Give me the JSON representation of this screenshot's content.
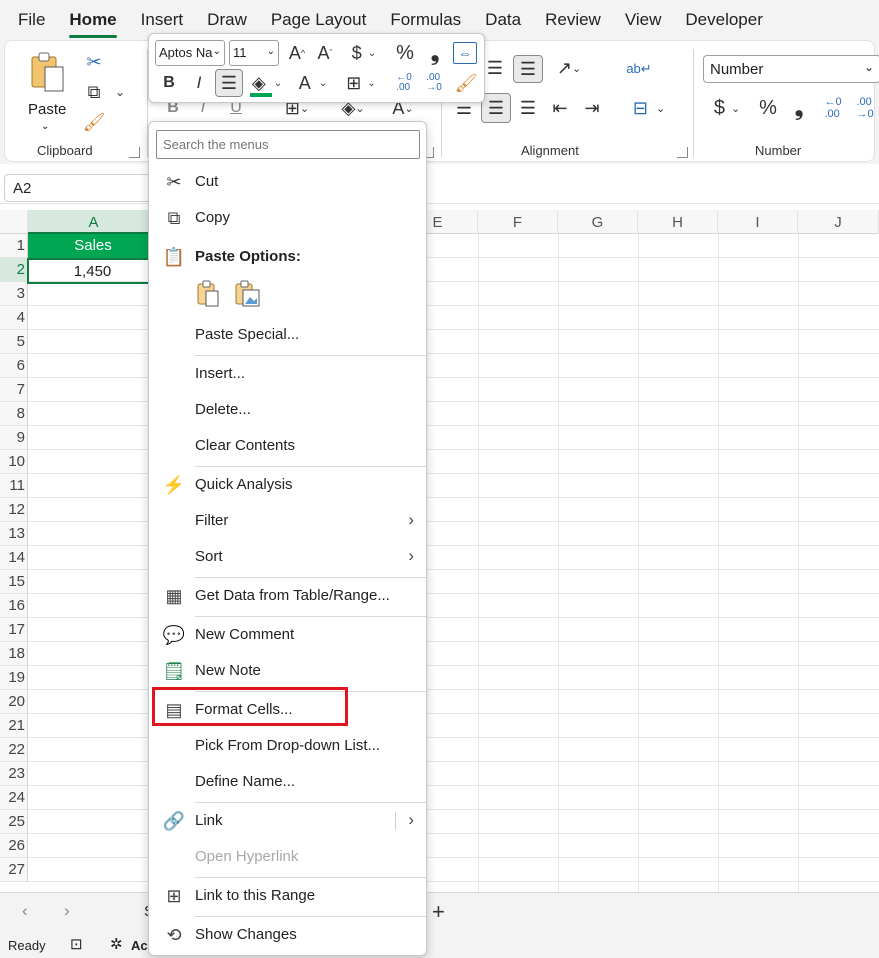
{
  "menubar": {
    "tabs": [
      "File",
      "Home",
      "Insert",
      "Draw",
      "Page Layout",
      "Formulas",
      "Data",
      "Review",
      "View",
      "Developer"
    ],
    "active": "Home"
  },
  "ribbon": {
    "clipboard": {
      "paste_label": "Paste",
      "group_label": "Clipboard"
    },
    "alignment": {
      "group_label": "Alignment"
    },
    "number": {
      "group_label": "Number",
      "format_value": "Number"
    }
  },
  "mini_toolbar": {
    "font_name": "Aptos Na",
    "font_size": "11"
  },
  "namebox": {
    "value": "A2"
  },
  "grid": {
    "columns": [
      "A",
      "E",
      "F",
      "G",
      "H",
      "I",
      "J"
    ],
    "rows": [
      "1",
      "2",
      "3",
      "4",
      "5",
      "6",
      "7",
      "8",
      "9",
      "10",
      "11",
      "12",
      "13",
      "14",
      "15",
      "16",
      "17",
      "18",
      "19",
      "20",
      "21",
      "22",
      "23",
      "24",
      "25",
      "26",
      "27"
    ],
    "a1": "Sales",
    "a2": "1,450"
  },
  "context_menu": {
    "search_placeholder": "Search the menus",
    "items": {
      "cut": "Cut",
      "copy": "Copy",
      "paste_options": "Paste Options:",
      "paste_special": "Paste Special...",
      "insert": "Insert...",
      "delete": "Delete...",
      "clear_contents": "Clear Contents",
      "quick_analysis": "Quick Analysis",
      "filter": "Filter",
      "sort": "Sort",
      "get_data": "Get Data from Table/Range...",
      "new_comment": "New Comment",
      "new_note": "New Note",
      "format_cells": "Format Cells...",
      "pick_dropdown": "Pick From Drop-down List...",
      "define_name": "Define Name...",
      "link": "Link",
      "open_hyperlink": "Open Hyperlink",
      "link_range": "Link to this Range",
      "show_changes": "Show Changes"
    }
  },
  "statusbar": {
    "ready": "Ready",
    "accessibility": "Ac",
    "sheet_partial": "S"
  },
  "accent_color": "#107c41",
  "header_fill": "#00a651",
  "highlight_color": "#e0141e"
}
